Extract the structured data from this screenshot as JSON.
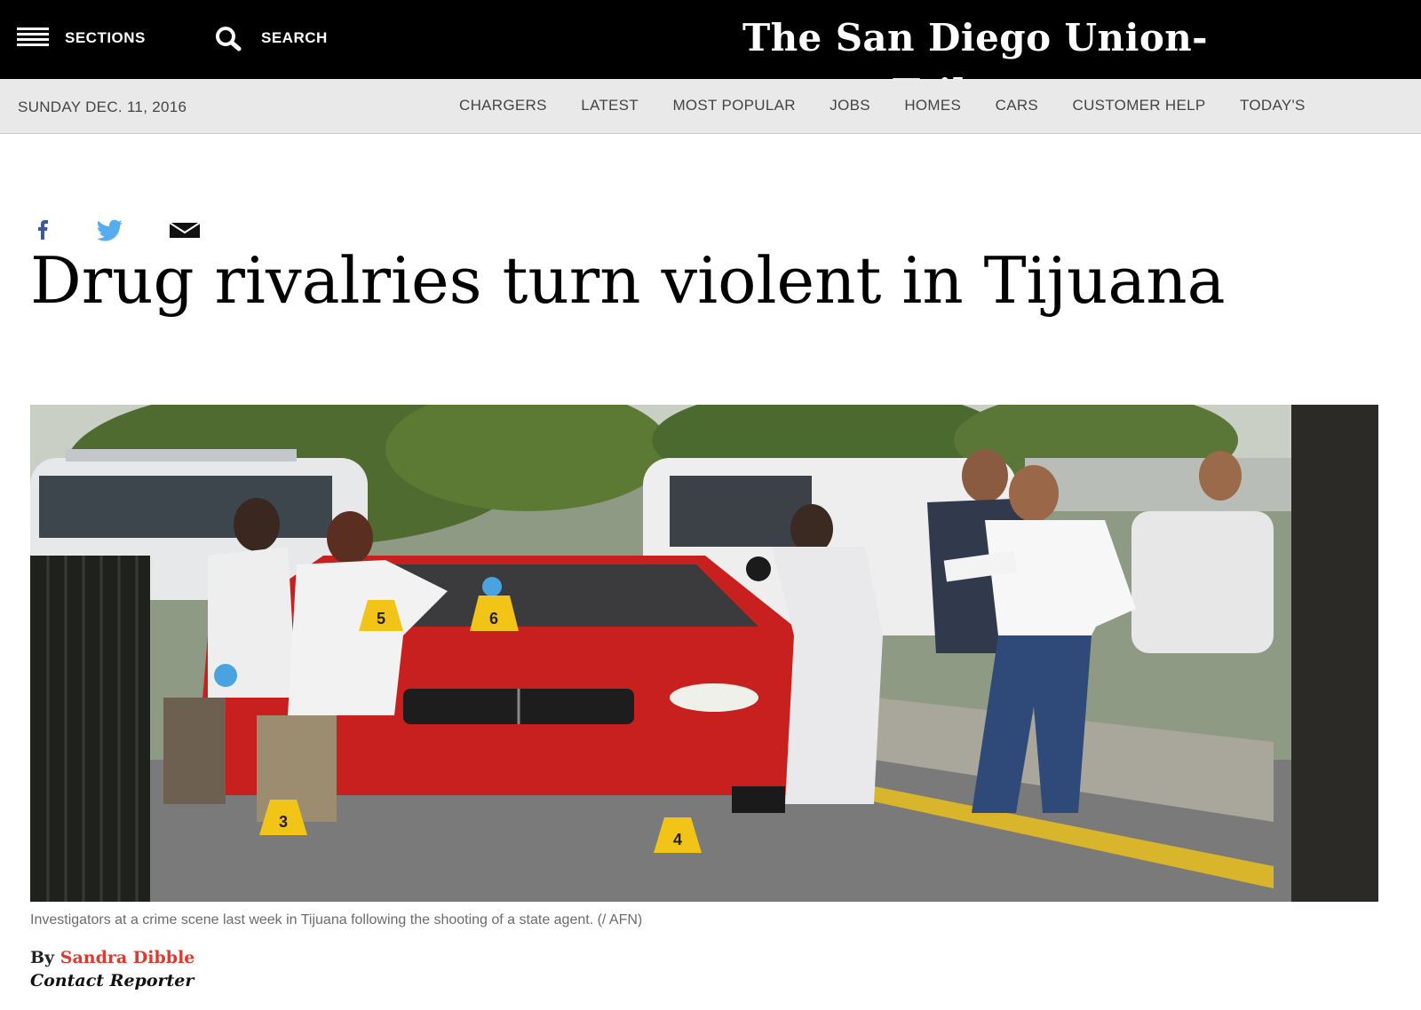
{
  "header": {
    "sections_label": "SECTIONS",
    "search_label": "SEARCH",
    "logo_text": "The San Diego Union-Tribune"
  },
  "nav": {
    "date": "SUNDAY DEC. 11, 2016",
    "items": [
      "CHARGERS",
      "LATEST",
      "MOST POPULAR",
      "JOBS",
      "HOMES",
      "CARS",
      "CUSTOMER HELP",
      "TODAY'S"
    ]
  },
  "share": {
    "icons": [
      "facebook-icon",
      "twitter-icon",
      "email-icon"
    ],
    "facebook_color": "#3b5998",
    "twitter_color": "#55acee"
  },
  "article": {
    "headline": "Drug rivalries turn violent in Tijuana",
    "caption": "Investigators at a crime scene last week in Tijuana following the shooting of a state agent. (/ AFN)",
    "byline_prefix": "By",
    "author": "Sandra Dibble",
    "contact": "Contact Reporter"
  },
  "photo": {
    "evidence_markers": [
      "5",
      "6",
      "3",
      "4"
    ]
  },
  "colors": {
    "masthead": "#000000",
    "navbar": "#e9e9e9",
    "author": "#e0382f"
  }
}
